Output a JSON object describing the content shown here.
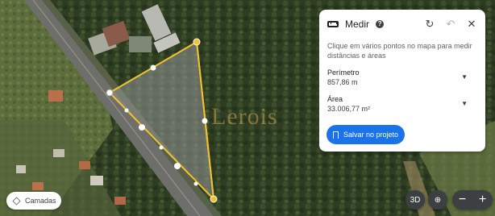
{
  "map": {
    "watermark": "Lerois"
  },
  "measure_panel": {
    "title": "Medir",
    "help_icon": "help-icon",
    "refresh_icon": "refresh-icon",
    "undo_icon": "undo-icon",
    "close_icon": "close-icon",
    "instructions": "Clique em vários pontos no mapa para medir distâncias e áreas",
    "perimeter_label": "Perímetro",
    "perimeter_value": "857,86 m",
    "area_label": "Área",
    "area_value": "33.006,77 m²",
    "save_button": "Salvar no projeto"
  },
  "controls": {
    "layers_label": "Camadas",
    "three_d_label": "3D",
    "location_icon": "location-icon",
    "zoom_out": "−",
    "zoom_in": "+"
  },
  "colors": {
    "accent": "#1a73e8",
    "measure_line": "#f2c12e"
  }
}
